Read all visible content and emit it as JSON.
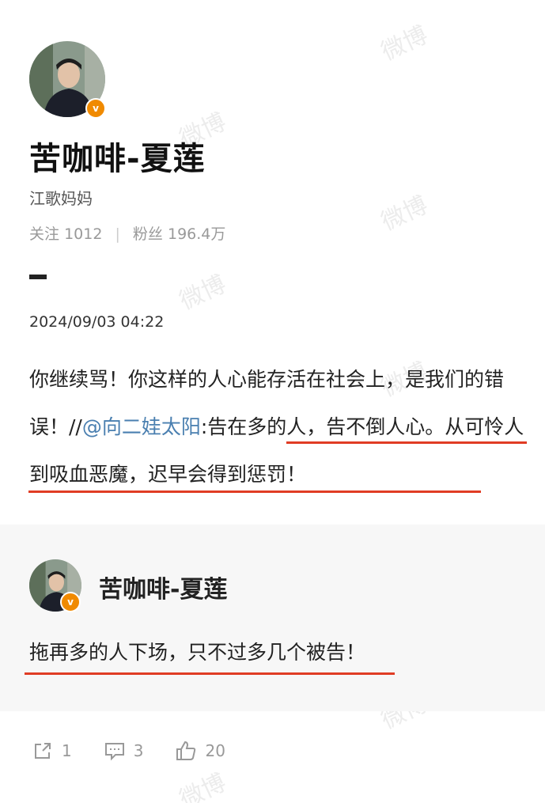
{
  "profile": {
    "name": "苦咖啡-夏莲",
    "bio": "江歌妈妈",
    "following_label": "关注",
    "following_count": "1012",
    "separator": "|",
    "fans_label": "粉丝",
    "fans_count": "196.4万",
    "verified_badge": "v"
  },
  "post": {
    "timestamp": "2024/09/03 04:22",
    "text_part1": "你继续骂！你这样的人心能存活在社会上，是我们的错误！//",
    "mention": "@向二娃太阳",
    "text_part2": ":告在多的人，告不倒人心。从可怜人到吸血恶魔，迟早会得到惩罚！"
  },
  "repost": {
    "name": "苦咖啡-夏莲",
    "text": "拖再多的人下场，只不过多几个被告！",
    "verified_badge": "v"
  },
  "actions": {
    "share_count": "1",
    "comment_count": "3",
    "like_count": "20"
  },
  "watermark": "微博",
  "colors": {
    "mention": "#4a7fb0",
    "underline": "#e03c24",
    "badge": "#f08a00"
  }
}
